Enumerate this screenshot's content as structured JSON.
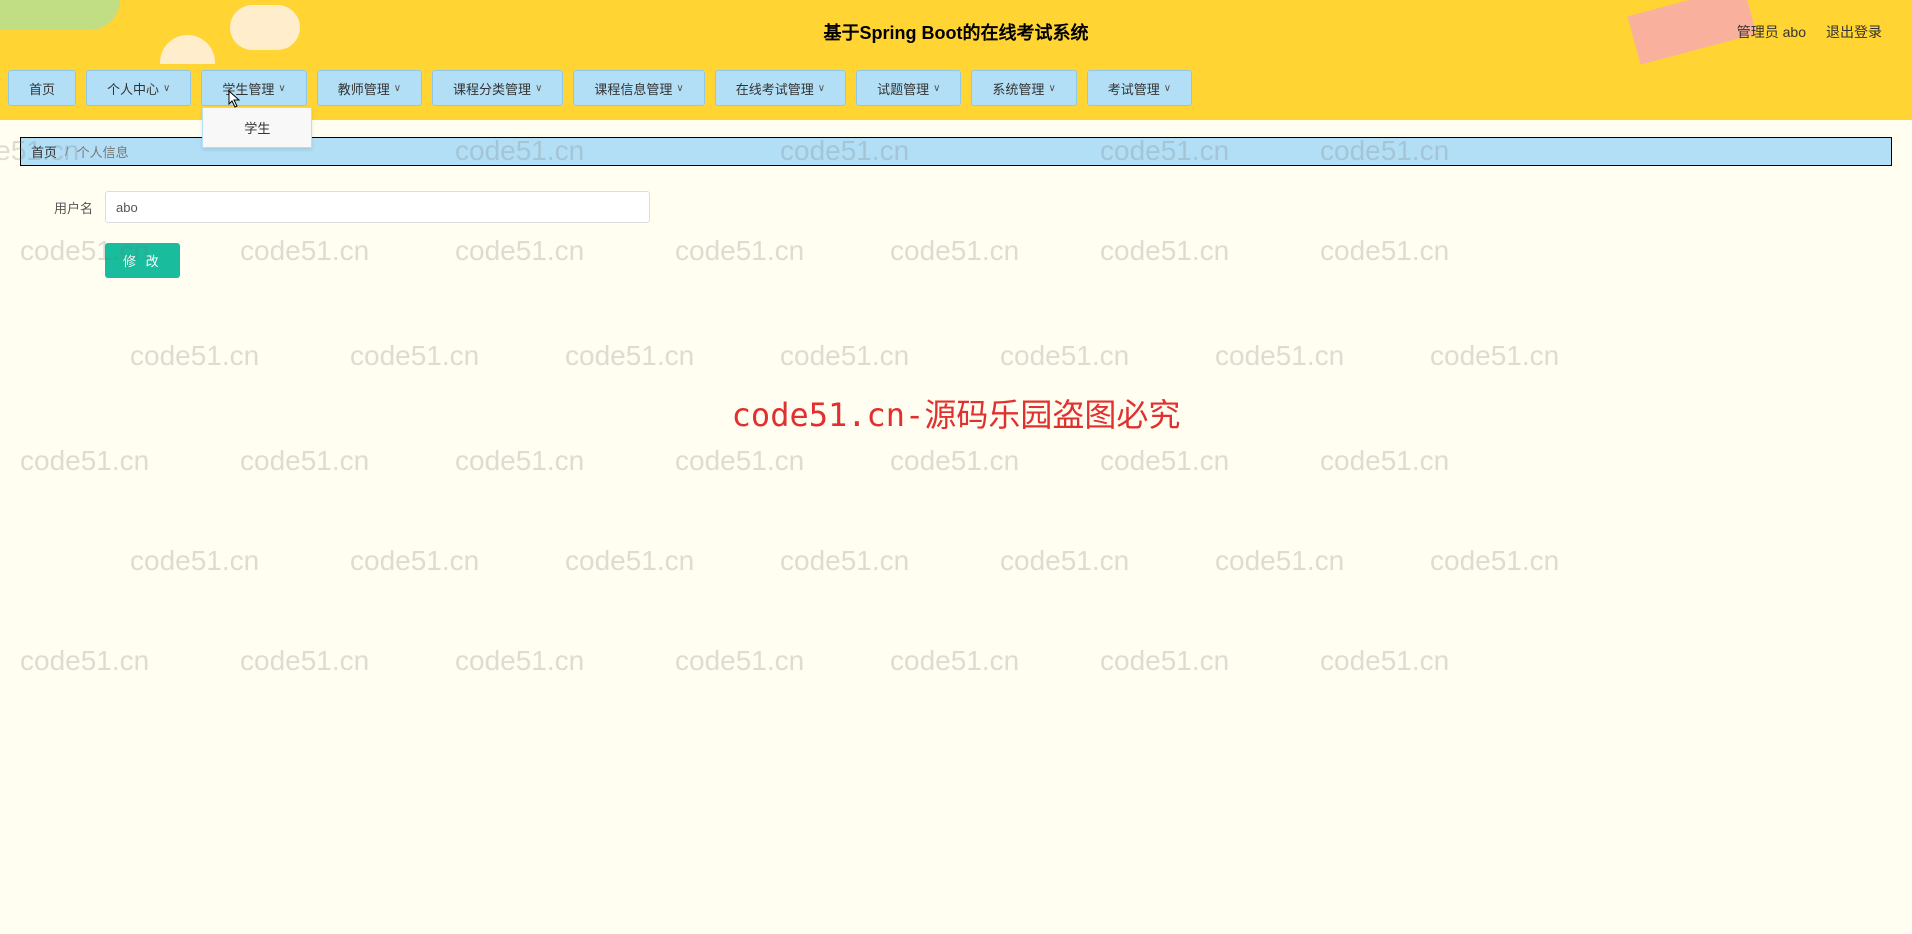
{
  "header": {
    "title": "基于Spring Boot的在线考试系统",
    "user_label": "管理员 abo",
    "logout_label": "退出登录"
  },
  "nav": {
    "items": [
      {
        "label": "首页",
        "has_dropdown": false
      },
      {
        "label": "个人中心",
        "has_dropdown": true
      },
      {
        "label": "学生管理",
        "has_dropdown": true,
        "open": true,
        "children": [
          {
            "label": "学生"
          }
        ]
      },
      {
        "label": "教师管理",
        "has_dropdown": true
      },
      {
        "label": "课程分类管理",
        "has_dropdown": true
      },
      {
        "label": "课程信息管理",
        "has_dropdown": true
      },
      {
        "label": "在线考试管理",
        "has_dropdown": true
      },
      {
        "label": "试题管理",
        "has_dropdown": true
      },
      {
        "label": "系统管理",
        "has_dropdown": true
      },
      {
        "label": "考试管理",
        "has_dropdown": true
      }
    ]
  },
  "breadcrumb": {
    "home": "首页",
    "separator": "/",
    "current": "个人信息"
  },
  "form": {
    "username_label": "用户名",
    "username_value": "abo",
    "submit_label": "修 改"
  },
  "watermark": {
    "text": "code51.cn",
    "center_text": "code51.cn-源码乐园盗图必究"
  }
}
